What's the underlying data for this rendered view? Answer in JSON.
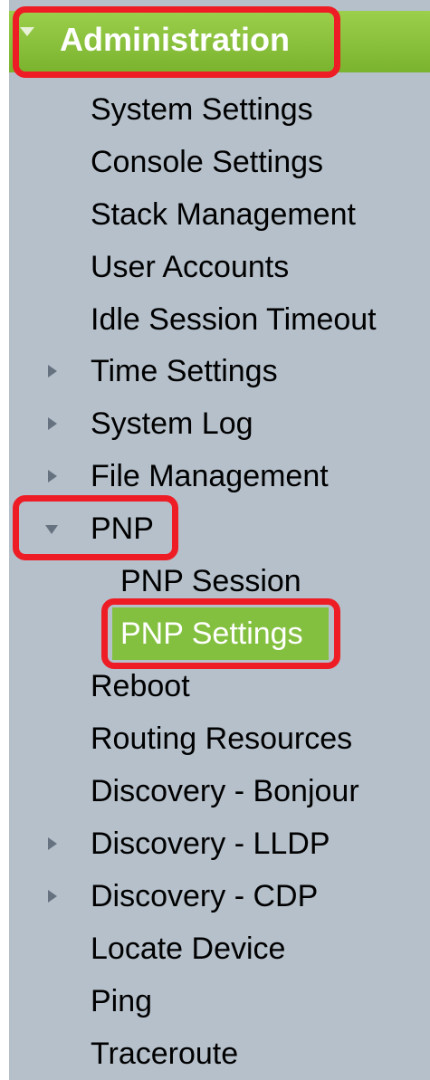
{
  "section": {
    "title": "Administration",
    "expanded": true
  },
  "menu": {
    "items": [
      {
        "label": "System Settings",
        "arrow": "none"
      },
      {
        "label": "Console Settings",
        "arrow": "none"
      },
      {
        "label": "Stack Management",
        "arrow": "none"
      },
      {
        "label": "User Accounts",
        "arrow": "none"
      },
      {
        "label": "Idle Session Timeout",
        "arrow": "none"
      },
      {
        "label": "Time Settings",
        "arrow": "collapsed"
      },
      {
        "label": "System Log",
        "arrow": "collapsed"
      },
      {
        "label": "File Management",
        "arrow": "collapsed"
      },
      {
        "label": "PNP",
        "arrow": "expanded"
      },
      {
        "label": "PNP Session",
        "arrow": "none",
        "level": 2
      },
      {
        "label": "PNP Settings",
        "arrow": "none",
        "level": 2,
        "selected": true
      },
      {
        "label": "Reboot",
        "arrow": "none"
      },
      {
        "label": "Routing Resources",
        "arrow": "none"
      },
      {
        "label": "Discovery - Bonjour",
        "arrow": "none"
      },
      {
        "label": "Discovery - LLDP",
        "arrow": "collapsed"
      },
      {
        "label": "Discovery - CDP",
        "arrow": "collapsed"
      },
      {
        "label": "Locate Device",
        "arrow": "none"
      },
      {
        "label": "Ping",
        "arrow": "none"
      },
      {
        "label": "Traceroute",
        "arrow": "none"
      }
    ]
  },
  "colors": {
    "panel_bg": "#b5c0cb",
    "header_green": "#8cc33f",
    "selected_green": "#84c040",
    "highlight_red": "#ee1c24",
    "arrow_gray": "#667280"
  }
}
